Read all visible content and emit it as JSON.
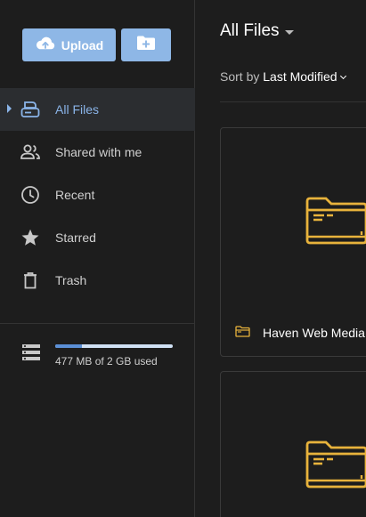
{
  "sidebar": {
    "upload_label": "Upload",
    "items": [
      {
        "label": "All Files",
        "icon": "drive-icon"
      },
      {
        "label": "Shared with me",
        "icon": "people-icon"
      },
      {
        "label": "Recent",
        "icon": "clock-icon"
      },
      {
        "label": "Starred",
        "icon": "star-icon"
      },
      {
        "label": "Trash",
        "icon": "trash-icon"
      }
    ],
    "storage": {
      "text": "477 MB of 2 GB used",
      "used_fraction": 0.23
    }
  },
  "main": {
    "title": "All Files",
    "sort": {
      "prefix": "Sort by",
      "value": "Last Modified"
    },
    "files": [
      {
        "name": "Haven Web Media",
        "type": "folder"
      },
      {
        "name": "",
        "type": "folder"
      }
    ]
  },
  "colors": {
    "accent": "#8eb7e6",
    "active_text": "#8ab4e8",
    "folder": "#e8b33c",
    "background": "#1d1d1d"
  }
}
